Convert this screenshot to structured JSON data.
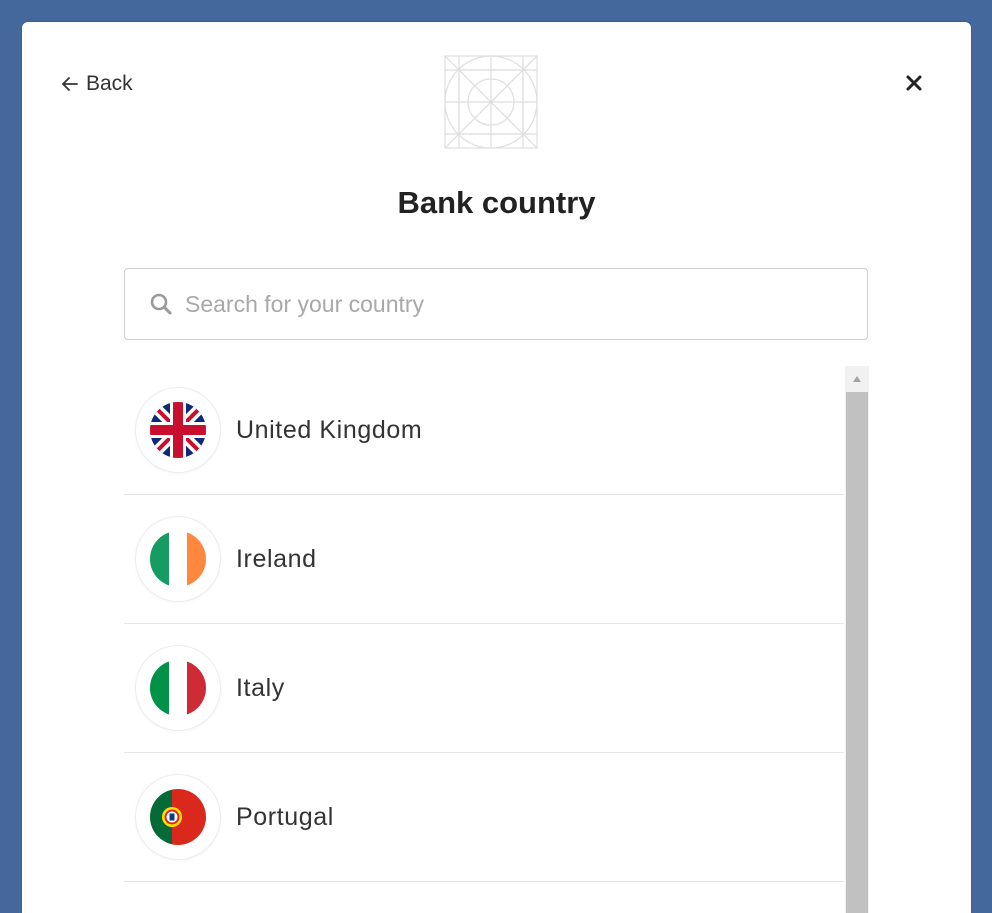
{
  "header": {
    "back_label": "Back",
    "title": "Bank country"
  },
  "search": {
    "placeholder": "Search for your country",
    "value": ""
  },
  "countries": [
    {
      "name": "United Kingdom",
      "flag": "uk-flag-icon"
    },
    {
      "name": "Ireland",
      "flag": "ireland-flag-icon"
    },
    {
      "name": "Italy",
      "flag": "italy-flag-icon"
    },
    {
      "name": "Portugal",
      "flag": "portugal-flag-icon"
    }
  ],
  "colors": {
    "background": "#44689b",
    "modal": "#ffffff",
    "title_text": "#222222",
    "scroll_thumb": "#c1c1c1"
  }
}
